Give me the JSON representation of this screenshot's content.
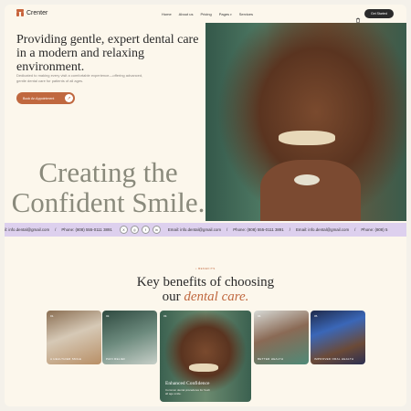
{
  "brand": {
    "name": "Crenter",
    "accent": "#c0683f"
  },
  "nav": {
    "items": [
      "Home",
      "About us",
      "Pricing",
      "Pages",
      "Services"
    ],
    "cart_icon": "shopping-bag-icon",
    "cta": "Get Started"
  },
  "hero": {
    "title": "Providing gentle, expert dental care in a modern and relaxing environment.",
    "text": "Dedicated to making every visit a comfortable experience—offering advanced, gentle dental care for patients of all ages.",
    "button": "Book An Appointment",
    "big_heading_1": "Creating the",
    "big_heading_2": "Confident Smile."
  },
  "strip": {
    "email": "Email: info.dental@gmail.com",
    "phone": "Phone: (808) 555-0111 3891",
    "email_cut": "il: info.dental@gmail.com",
    "phone_cut": "Phone: (808) 5",
    "socials": [
      "X",
      "◎",
      "f",
      "in"
    ]
  },
  "benefits": {
    "eyebrow": "• BENEFITS",
    "title_1": "Key benefits of choosing",
    "title_2": "our ",
    "title_accent": "dental care.",
    "cards": [
      {
        "num": "01.",
        "label": "A HEALTHIER SMILE"
      },
      {
        "num": "02.",
        "label": "PAIN RELIEF"
      },
      {
        "num": "03.",
        "title": "Enhanced Confidence",
        "desc": "Common dental procedures for fresh all age smile."
      },
      {
        "num": "04.",
        "label": "BETTER HEALTH"
      },
      {
        "num": "05.",
        "label": "IMPROVED ORAL HEALTH"
      }
    ]
  }
}
